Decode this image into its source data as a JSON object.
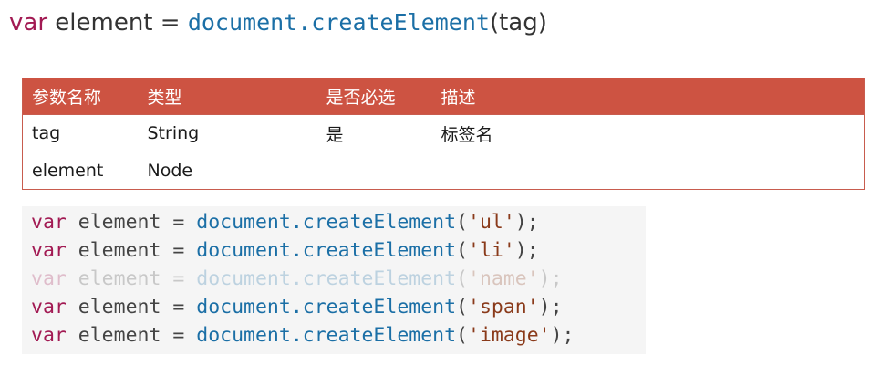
{
  "signature": {
    "keyword": "var",
    "variable": "element",
    "equals": "=",
    "call": "document.createElement",
    "args": "(tag)"
  },
  "table": {
    "headers": [
      "参数名称",
      "类型",
      "是否必选",
      "描述"
    ],
    "rows": [
      {
        "name": "tag",
        "type": "String",
        "required": "是",
        "desc": "标签名"
      },
      {
        "name": "element",
        "type": "Node",
        "required": "",
        "desc": ""
      }
    ]
  },
  "code": {
    "lines": [
      {
        "kw": "var",
        "var": "element",
        "op": "=",
        "fn": "document.createElement",
        "open": "(",
        "arg": "'ul'",
        "close": ");",
        "faded": false
      },
      {
        "kw": "var",
        "var": "element",
        "op": "=",
        "fn": "document.createElement",
        "open": "(",
        "arg": "'li'",
        "close": ");",
        "faded": false
      },
      {
        "kw": "var",
        "var": "element",
        "op": "=",
        "fn": "document.createElement",
        "open": "(",
        "arg": "'name'",
        "close": ");",
        "faded": true
      },
      {
        "kw": "var",
        "var": "element",
        "op": "=",
        "fn": "document.createElement",
        "open": "(",
        "arg": "'span'",
        "close": ");",
        "faded": false
      },
      {
        "kw": "var",
        "var": "element",
        "op": "=",
        "fn": "document.createElement",
        "open": "(",
        "arg": "'image'",
        "close": ");",
        "faded": false
      }
    ]
  },
  "colors": {
    "keyword": "#a21a53",
    "object": "#1b6fa6",
    "header_bg": "#cd5342",
    "border": "#c85c4e"
  }
}
